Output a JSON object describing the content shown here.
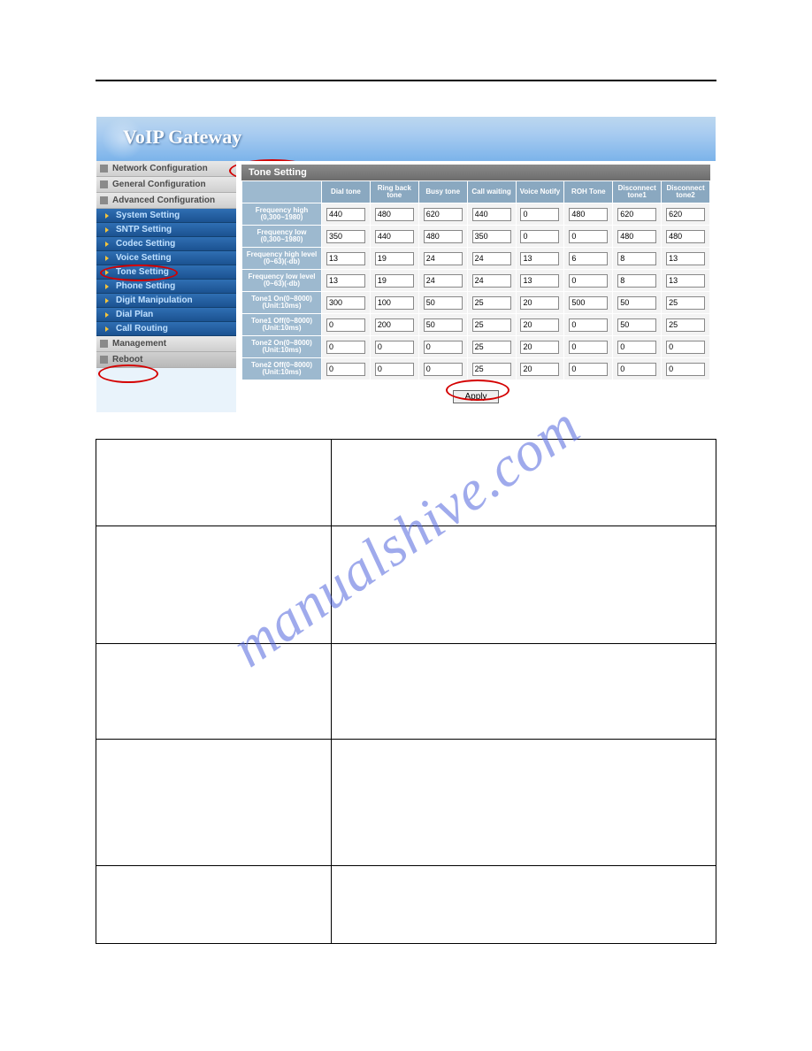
{
  "banner": {
    "title": "VoIP  Gateway"
  },
  "sidebar": {
    "categories": [
      {
        "label": "Network Configuration"
      },
      {
        "label": "General Configuration"
      },
      {
        "label": "Advanced Configuration",
        "items": [
          "System Setting",
          "SNTP Setting",
          "Codec Setting",
          "Voice Setting",
          "Tone Setting",
          "Phone Setting",
          "Digit Manipulation",
          "Dial Plan",
          "Call Routing"
        ]
      },
      {
        "label": "Management"
      },
      {
        "label": "Reboot"
      }
    ]
  },
  "section": {
    "title": "Tone Setting"
  },
  "columns": [
    "Dial tone",
    "Ring back tone",
    "Busy tone",
    "Call waiting",
    "Voice Notify",
    "ROH Tone",
    "Disconnect tone1",
    "Disconnect tone2"
  ],
  "rows": [
    {
      "label": "Frequency high (0,300~1980)",
      "vals": [
        "440",
        "480",
        "620",
        "440",
        "0",
        "480",
        "620",
        "620"
      ]
    },
    {
      "label": "Frequency low (0,300~1980)",
      "vals": [
        "350",
        "440",
        "480",
        "350",
        "0",
        "0",
        "480",
        "480"
      ]
    },
    {
      "label": "Frequency high level (0~63)(-db)",
      "vals": [
        "13",
        "19",
        "24",
        "24",
        "13",
        "6",
        "8",
        "13"
      ]
    },
    {
      "label": "Frequency low level (0~63)(-db)",
      "vals": [
        "13",
        "19",
        "24",
        "24",
        "13",
        "0",
        "8",
        "13"
      ]
    },
    {
      "label": "Tone1 On(0~8000) (Unit:10ms)",
      "vals": [
        "300",
        "100",
        "50",
        "25",
        "20",
        "500",
        "50",
        "25"
      ]
    },
    {
      "label": "Tone1 Off(0~8000) (Unit:10ms)",
      "vals": [
        "0",
        "200",
        "50",
        "25",
        "20",
        "0",
        "50",
        "25"
      ]
    },
    {
      "label": "Tone2 On(0~8000) (Unit:10ms)",
      "vals": [
        "0",
        "0",
        "0",
        "25",
        "20",
        "0",
        "0",
        "0"
      ]
    },
    {
      "label": "Tone2 Off(0~8000) (Unit:10ms)",
      "vals": [
        "0",
        "0",
        "0",
        "25",
        "20",
        "0",
        "0",
        "0"
      ]
    }
  ],
  "apply": {
    "label": "Apply"
  },
  "watermark": "manualshive.com"
}
